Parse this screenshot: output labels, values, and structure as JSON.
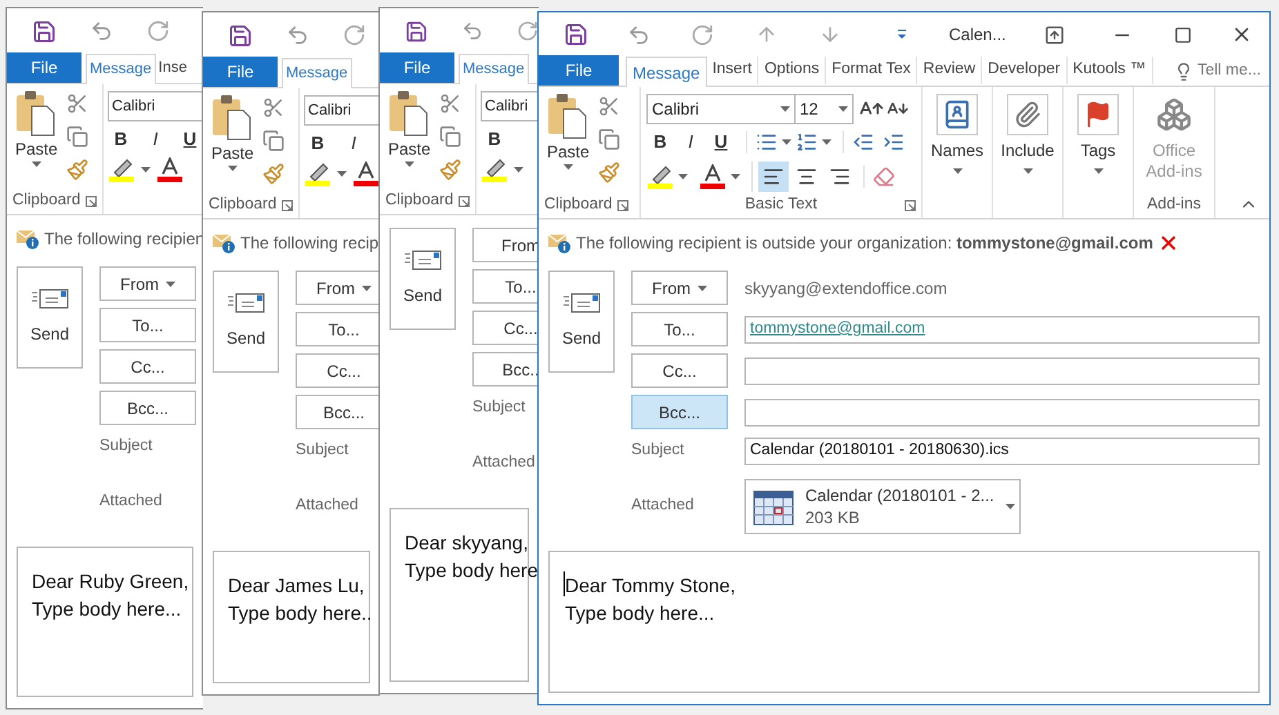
{
  "back_windows": [
    {
      "tabs": [
        {
          "label": "File",
          "kind": "file"
        },
        {
          "label": "Message",
          "kind": "tab",
          "selected": true
        },
        {
          "label": "Inse",
          "kind": "tab",
          "selected": false
        }
      ],
      "paste_label": "Paste",
      "clipboard_label": "Clipboard",
      "font": "Calibri",
      "format_buttons": [
        {
          "label": "B",
          "kind": "bold"
        },
        {
          "label": "I",
          "kind": "italic"
        },
        {
          "label": "U",
          "kind": "underline"
        }
      ],
      "notice": "The following recipien",
      "send_label": "Send",
      "address_buttons": [
        {
          "label": "From",
          "kind": "dropdown"
        },
        {
          "label": "To...",
          "kind": "plain"
        },
        {
          "label": "Cc...",
          "kind": "plain"
        },
        {
          "label": "Bcc...",
          "kind": "plain"
        }
      ],
      "subject_label": "Subject",
      "attached_label": "Attached",
      "body": [
        "Dear Ruby Green,",
        "Type body here..."
      ]
    },
    {
      "tabs": [
        {
          "label": "File",
          "kind": "file"
        },
        {
          "label": "Message",
          "kind": "tab",
          "selected": true
        }
      ],
      "paste_label": "Paste",
      "clipboard_label": "Clipboard",
      "font": "Calibri",
      "format_buttons": [
        {
          "label": "B",
          "kind": "bold"
        },
        {
          "label": "I",
          "kind": "italic"
        }
      ],
      "notice": "The following recip",
      "send_label": "Send",
      "address_buttons": [
        {
          "label": "From",
          "kind": "dropdown"
        },
        {
          "label": "To...",
          "kind": "plain"
        },
        {
          "label": "Cc...",
          "kind": "plain"
        },
        {
          "label": "Bcc...",
          "kind": "plain"
        }
      ],
      "subject_label": "Subject",
      "attached_label": "Attached",
      "body": [
        "Dear James Lu,",
        "Type body here.."
      ]
    },
    {
      "tabs": [
        {
          "label": "File",
          "kind": "file"
        },
        {
          "label": "Message",
          "kind": "tab",
          "selected": true
        }
      ],
      "paste_label": "Paste",
      "clipboard_label": "Clipboard",
      "font": "Calibri",
      "format_buttons": [
        {
          "label": "B",
          "kind": "bold"
        }
      ],
      "send_label": "Send",
      "address_buttons": [
        {
          "label": "From",
          "kind": "plain"
        },
        {
          "label": "To...",
          "kind": "plain"
        },
        {
          "label": "Cc...",
          "kind": "plain"
        },
        {
          "label": "Bcc..",
          "kind": "plain"
        }
      ],
      "subject_label": "Subject",
      "attached_label": "Attached",
      "body": [
        "Dear skyyang,",
        "Type body here"
      ]
    }
  ],
  "front": {
    "title": "Calen...",
    "tabs": [
      {
        "label": "File",
        "kind": "file"
      },
      {
        "label": "Message",
        "kind": "tab",
        "selected": true
      },
      {
        "label": "Insert",
        "kind": "tab",
        "selected": false
      },
      {
        "label": "Options",
        "kind": "tab",
        "selected": false
      },
      {
        "label": "Format Tex",
        "kind": "tab",
        "selected": false
      },
      {
        "label": "Review",
        "kind": "tab",
        "selected": false
      },
      {
        "label": "Developer",
        "kind": "tab",
        "selected": false
      },
      {
        "label": "Kutools ™",
        "kind": "tab",
        "selected": false
      }
    ],
    "tell_me": "Tell me...",
    "ribbon": {
      "paste_label": "Paste",
      "clipboard_label": "Clipboard",
      "font": "Calibri",
      "size": "12",
      "format_buttons": [
        {
          "label": "B",
          "kind": "bold"
        },
        {
          "label": "I",
          "kind": "italic"
        },
        {
          "label": "U",
          "kind": "underline"
        }
      ],
      "alignment": [
        {
          "selected": true
        },
        {
          "selected": false
        },
        {
          "selected": false
        }
      ],
      "basic_text_label": "Basic Text",
      "big_buttons": [
        {
          "label": "Names",
          "disabled": false,
          "dropdown": true
        },
        {
          "label": "Include",
          "disabled": false,
          "dropdown": true
        },
        {
          "label": "Tags",
          "disabled": false,
          "dropdown": true
        },
        {
          "label": "Office Add-ins",
          "disabled": true,
          "dropdown": false,
          "group_label": "Add-ins"
        }
      ]
    },
    "notice": "The following recipient is outside your organization: **tommystone@gmail.com**",
    "send_label": "Send",
    "address_buttons": [
      {
        "label": "From",
        "kind": "dropdown",
        "selected": false
      },
      {
        "label": "To...",
        "kind": "plain",
        "selected": false
      },
      {
        "label": "Cc...",
        "kind": "plain",
        "selected": false
      },
      {
        "label": "Bcc...",
        "kind": "plain",
        "selected": true
      }
    ],
    "from_value": "skyyang@extendoffice.com",
    "to_value": "tommystone@gmail.com",
    "subject_label": "Subject",
    "subject_value": "Calendar (20180101 - 20180630).ics",
    "attached_label": "Attached",
    "attachment": {
      "name": "Calendar (20180101 - 2...",
      "size": "203 KB"
    },
    "body": [
      "Dear Tommy Stone,",
      "Type body here..."
    ]
  }
}
